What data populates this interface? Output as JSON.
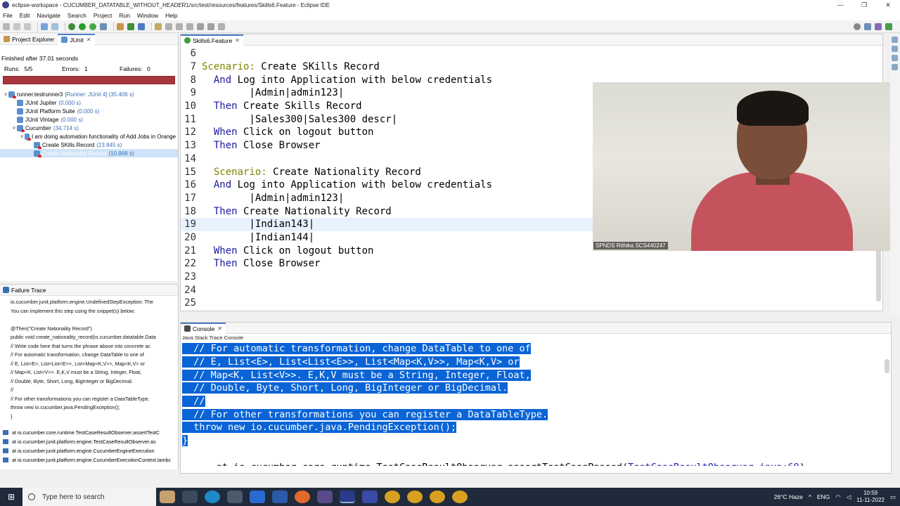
{
  "window": {
    "title": "eclipse-workspace - CUCUMBER_DATATABLE_WITHOUT_HEADER1/src/test/resources/features/Skills6.Feature - Eclipse IDE",
    "minimize": "—",
    "maximize": "❐",
    "close": "✕"
  },
  "menu": [
    "File",
    "Edit",
    "Navigate",
    "Search",
    "Project",
    "Run",
    "Window",
    "Help"
  ],
  "left_tabs": {
    "project_explorer": "Project Explorer",
    "junit": "JUnit"
  },
  "junit": {
    "status": "Finished after 37.01 seconds",
    "runs_label": "Runs:",
    "runs_value": "5/5",
    "errors_label": "Errors:",
    "errors_value": "1",
    "failures_label": "Failures:",
    "failures_value": "0",
    "tree": [
      {
        "label": "runner.testrunner3",
        "time": "[Runner: JUnit 4] (35.406 s)",
        "level": 0,
        "twisty": "∨"
      },
      {
        "label": "JUnit Jupiter",
        "time": "(0.000 s)",
        "level": 1,
        "twisty": ""
      },
      {
        "label": "JUnit Platform Suite",
        "time": "(0.000 s)",
        "level": 1,
        "twisty": ""
      },
      {
        "label": "JUnit Vintage",
        "time": "(0.000 s)",
        "level": 1,
        "twisty": ""
      },
      {
        "label": "Cucumber",
        "time": "(34.714 s)",
        "level": 1,
        "twisty": "∨"
      },
      {
        "label": "I am doing automation functionality of Add Jobs in Orange",
        "time": "",
        "level": 2,
        "twisty": "∨"
      },
      {
        "label": "Create SKills Record",
        "time": "(23.845 s)",
        "level": 3,
        "twisty": ""
      },
      {
        "label": "Create Nationality Record",
        "time": "(10.868 s)",
        "level": 3,
        "twisty": ""
      }
    ]
  },
  "failure_trace": {
    "title": "Failure Trace",
    "lines": [
      "io.cucumber.junit.platform.engine.UndefinedStepException: The",
      "You can implement this step using the snippet(s) below:",
      "",
      "@Then(\"Create Nationality Record\")",
      "public void create_nationality_record(io.cucumber.datatable.Data",
      "    // Write code here that turns the phrase above into concrete ac",
      "    // For automatic transformation, change DataTable to one of",
      "    // E, List<E>, List<List<E>>, List<Map<K,V>>, Map<K,V> or",
      "    // Map<K, List<V>>. E,K,V must be a String, Integer, Float,",
      "    // Double, Byte, Short, Long, BigInteger or BigDecimal.",
      "    //",
      "    // For other transformations you can register a DataTableType.",
      "    throw new io.cucumber.java.PendingException();",
      "}"
    ],
    "stack": [
      "at io.cucumber.core.runtime.TestCaseResultObserver.assertTestC",
      "at io.cucumber.junit.platform.engine.TestCaseResultObserver.as",
      "at io.cucumber.junit.platform.engine.CucumberEngineExecution",
      "at io.cucumber.junit.platform.engine.CucumberExecutionContext.lambc"
    ]
  },
  "editor": {
    "tab": "Skills6.Feature",
    "lines": [
      {
        "n": "6",
        "kw": "",
        "text": ""
      },
      {
        "n": "7",
        "kw": "Scenario:",
        "text": " Create SKills Record",
        "indent": 0
      },
      {
        "n": "8",
        "kw": "And",
        "text": " Log into Application with below credentials",
        "indent": 1
      },
      {
        "n": "9",
        "kw": "",
        "text": "        |Admin|admin123|",
        "indent": 0
      },
      {
        "n": "10",
        "kw": "Then",
        "text": " Create Skills Record",
        "indent": 1
      },
      {
        "n": "11",
        "kw": "",
        "text": "        |Sales300|Sales300 descr|",
        "indent": 0
      },
      {
        "n": "12",
        "kw": "When",
        "text": " Click on logout button",
        "indent": 1
      },
      {
        "n": "13",
        "kw": "Then",
        "text": " Close Browser",
        "indent": 1
      },
      {
        "n": "14",
        "kw": "",
        "text": "",
        "indent": 0
      },
      {
        "n": "15",
        "kw": "Scenario:",
        "text": " Create Nationality Record",
        "indent": 1
      },
      {
        "n": "16",
        "kw": "And",
        "text": " Log into Application with below credentials",
        "indent": 1
      },
      {
        "n": "17",
        "kw": "",
        "text": "        |Admin|admin123|",
        "indent": 0
      },
      {
        "n": "18",
        "kw": "Then",
        "text": " Create Nationality Record",
        "indent": 1
      },
      {
        "n": "19",
        "kw": "",
        "text": "        |Indian143|",
        "indent": 0
      },
      {
        "n": "20",
        "kw": "",
        "text": "        |Indian144|",
        "indent": 0
      },
      {
        "n": "21",
        "kw": "When",
        "text": " Click on logout button",
        "indent": 1
      },
      {
        "n": "22",
        "kw": "Then",
        "text": " Close Browser",
        "indent": 1
      },
      {
        "n": "23",
        "kw": "",
        "text": "",
        "indent": 0
      },
      {
        "n": "24",
        "kw": "",
        "text": "",
        "indent": 0
      },
      {
        "n": "25",
        "kw": "",
        "text": "",
        "indent": 0
      }
    ]
  },
  "webcam": {
    "caption": "SPNDS Rithika SCS440247"
  },
  "console": {
    "tab": "Console",
    "subtitle": "Java Stack Trace Console",
    "lines": [
      "  // For automatic transformation, change DataTable to one of",
      "  // E, List<E>, List<List<E>>, List<Map<K,V>>, Map<K,V> or",
      "  // Map<K, List<V>>. E,K,V must be a String, Integer, Float,",
      "  // Double, Byte, Short, Long, BigInteger or BigDecimal.",
      "  //",
      "  // For other transformations you can register a DataTableType.",
      "  throw new io.cucumber.java.PendingException();",
      "}"
    ],
    "last_line_prefix": "      at io.cucumber.core.runtime.TestCaseResultObserver.assertTestCasePassed(",
    "last_line_link": "TestCaseResultObserver.java:69",
    "last_line_suffix": ")"
  },
  "taskbar": {
    "search_placeholder": "Type here to search",
    "weather": "26°C Haze",
    "lang": "ENG",
    "time": "10:59",
    "date": "11-11-2022"
  },
  "colors": {
    "error_bar": "#a8353b",
    "selection": "#0a64d6",
    "keyword": "#7f8400"
  }
}
